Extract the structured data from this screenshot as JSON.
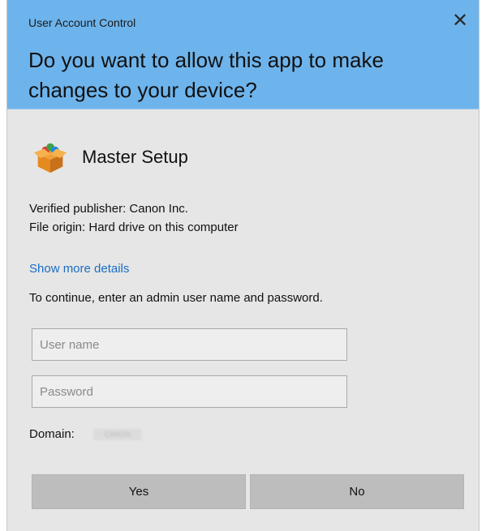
{
  "window": {
    "title": "User Account Control",
    "close_icon": "close-icon"
  },
  "prompt": {
    "question": "Do you want to allow this app to make changes to your device?"
  },
  "app": {
    "name": "Master Setup",
    "icon": "box-package-icon"
  },
  "details": {
    "publisher_line": "Verified publisher: Canon Inc.",
    "origin_line": "File origin: Hard drive on this computer",
    "more_link": "Show more details",
    "instruction": "To continue, enter an admin user name and password."
  },
  "credentials": {
    "username_placeholder": "User name",
    "username_value": "",
    "password_placeholder": "Password",
    "password_value": "",
    "domain_label": "Domain:",
    "domain_value": "CANON"
  },
  "buttons": {
    "yes_label": "Yes",
    "no_label": "No"
  },
  "colors": {
    "header_bg": "#6eb4ec",
    "body_bg": "#e6e6e6",
    "link": "#1a6ec2",
    "button_bg": "#bdbdbd"
  }
}
